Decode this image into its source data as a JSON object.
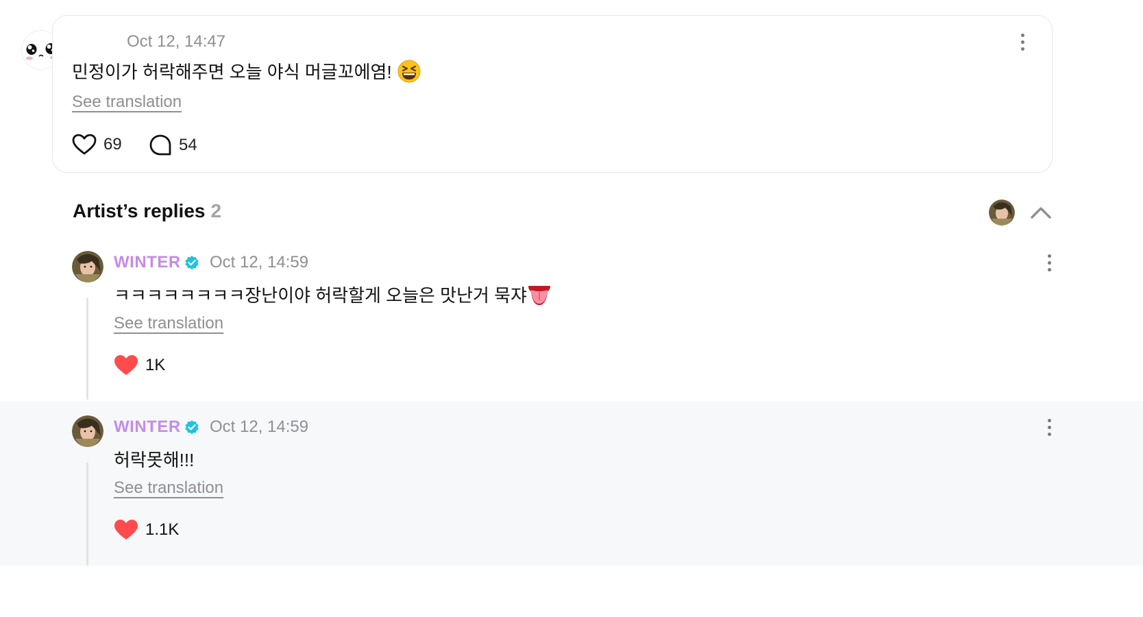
{
  "post": {
    "time": "Oct 12, 14:47",
    "text": "민정이가 허락해주면 오늘 야식 머글꼬에염!",
    "text_emoji": "grinning-squinting-face",
    "see_translation": "See translation",
    "likes": "69",
    "comments": "54"
  },
  "replies_section": {
    "title": "Artist’s replies",
    "count": "2"
  },
  "replies": [
    {
      "author": "WINTER",
      "time": "Oct 12, 14:59",
      "text": "ㅋㅋㅋㅋㅋㅋㅋㅋ장난이야 허락할게 오늘은 맛난거 묵쟈",
      "text_emoji": "tongue",
      "see_translation": "See translation",
      "likes": "1K"
    },
    {
      "author": "WINTER",
      "time": "Oct 12, 14:59",
      "text": "허락못해!!!",
      "see_translation": "See translation",
      "likes": "1.1K"
    }
  ],
  "colors": {
    "artist_name": "#c58be6",
    "verified_badge": "#1fc3e0",
    "liked_heart": "#ff4b4b",
    "muted_text": "#8e8e93",
    "highlight_row": "#f7f8fa"
  }
}
